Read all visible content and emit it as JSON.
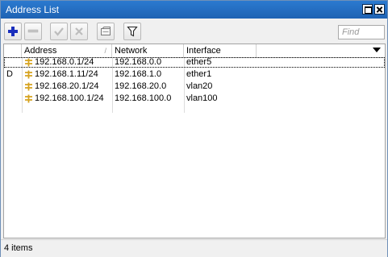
{
  "window": {
    "title": "Address List"
  },
  "toolbar": {
    "buttons": [
      {
        "name": "add-button",
        "icon": "plus-icon",
        "enabled": true
      },
      {
        "name": "remove-button",
        "icon": "minus-icon",
        "enabled": false
      },
      {
        "name": "enable-button",
        "icon": "check-icon",
        "enabled": false
      },
      {
        "name": "disable-button",
        "icon": "cross-icon",
        "enabled": false
      },
      {
        "name": "comment-button",
        "icon": "note-icon",
        "enabled": false
      },
      {
        "name": "filter-button",
        "icon": "funnel-icon",
        "enabled": true
      }
    ],
    "find_placeholder": "Find"
  },
  "table": {
    "columns": [
      "Address",
      "Network",
      "Interface"
    ],
    "sort_column": "Address",
    "rows": [
      {
        "flag": "",
        "address": "192.168.0.1/24",
        "network": "192.168.0.0",
        "interface": "ether5",
        "selected": true
      },
      {
        "flag": "D",
        "address": "192.168.1.11/24",
        "network": "192.168.1.0",
        "interface": "ether1",
        "selected": false
      },
      {
        "flag": "",
        "address": "192.168.20.1/24",
        "network": "192.168.20.0",
        "interface": "vlan20",
        "selected": false
      },
      {
        "flag": "",
        "address": "192.168.100.1/24",
        "network": "192.168.100.0",
        "interface": "vlan100",
        "selected": false
      }
    ]
  },
  "status": {
    "text": "4 items"
  },
  "colors": {
    "title_bar": "#1e62b3",
    "add_icon": "#1a2fbd",
    "address_icon": "#d6a21e"
  }
}
